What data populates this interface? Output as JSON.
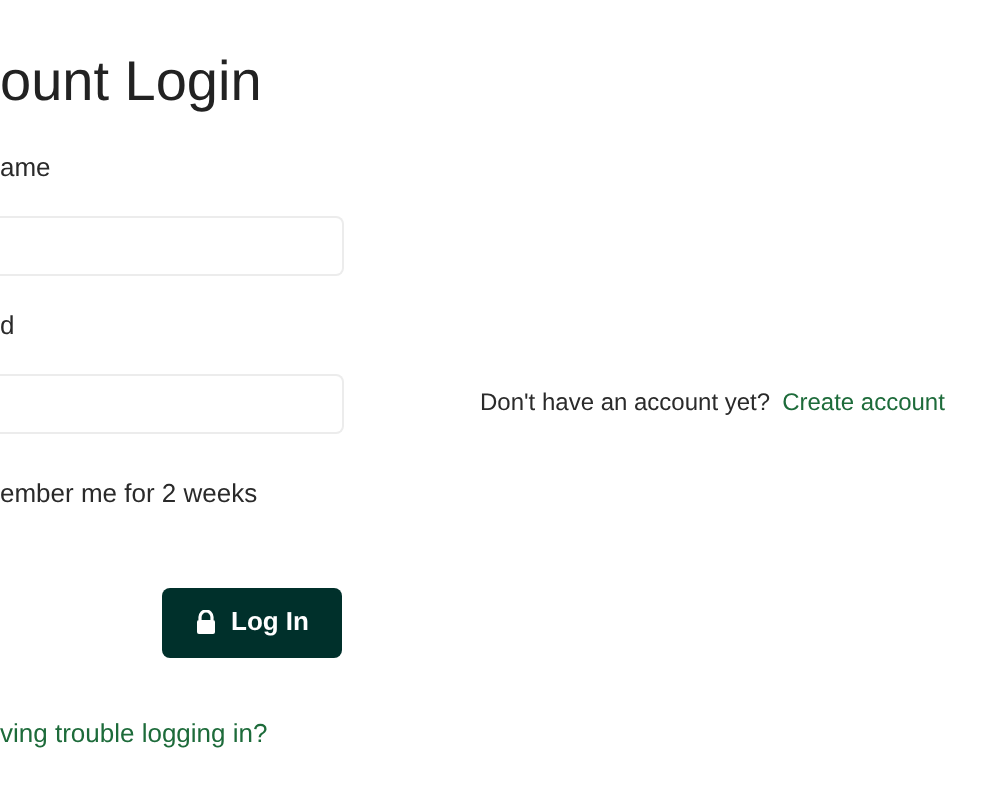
{
  "title": "ount Login",
  "fields": [
    {
      "label": "ame"
    },
    {
      "label": "d"
    }
  ],
  "remember": {
    "label": "ember me for 2 weeks"
  },
  "login_button": {
    "label": "Log In"
  },
  "help_link": "ving trouble logging in?",
  "signup": {
    "prompt": "Don't have an account yet?",
    "link": "Create account"
  }
}
